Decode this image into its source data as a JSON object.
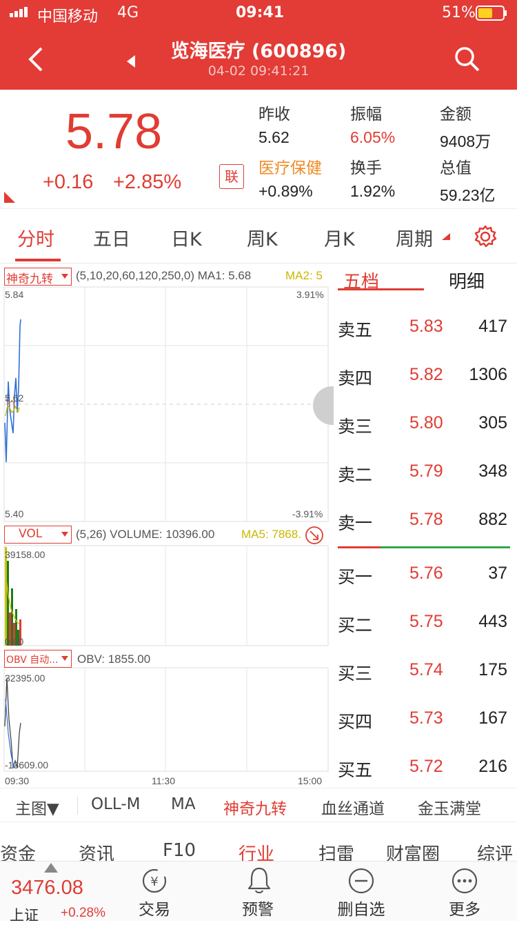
{
  "status_bar": {
    "carrier": "中国移动",
    "network": "4G",
    "time": "09:41",
    "battery": "51%"
  },
  "header": {
    "title": "览海医疗 (600896)",
    "subtitle": "04-02 09:41:21",
    "back_icon": "chevron-left-icon",
    "prev_icon": "caret-left-icon",
    "search_icon": "search-icon"
  },
  "quote": {
    "price": "5.78",
    "change": "+0.16",
    "change_pct": "+2.85%",
    "lian_label": "联",
    "stats": [
      {
        "label": "昨收",
        "value": "5.62",
        "label_color": "#333",
        "value_color": "#222"
      },
      {
        "label": "振幅",
        "value": "6.05%",
        "label_color": "#333",
        "value_color": "#e03c33"
      },
      {
        "label": "金额",
        "value": "9408万",
        "label_color": "#333",
        "value_color": "#222"
      },
      {
        "label": "医疗保健",
        "value": "+0.89%",
        "label_color": "#f08a24",
        "value_color": "#222"
      },
      {
        "label": "换手",
        "value": "1.92%",
        "label_color": "#333",
        "value_color": "#222"
      },
      {
        "label": "总值",
        "value": "59.23亿",
        "label_color": "#333",
        "value_color": "#222"
      }
    ]
  },
  "tabs": [
    "分时",
    "五日",
    "日K",
    "周K",
    "月K",
    "周期"
  ],
  "chart": {
    "main_select": "神奇九转",
    "main_indicator": "(5,10,20,60,120,250,0) MA1: 5.68",
    "ma2": "MA2: 5",
    "y_top": "5.84",
    "y_mid": "5.62",
    "y_bottom": "5.40",
    "pct_top": "3.91%",
    "pct_bottom": "-3.91%",
    "vol_select": "VOL",
    "vol_indicator": "(5,26) VOLUME: 10396.00",
    "vol_ma5": "MA5: 7868.",
    "vol_top": "39158.00",
    "vol_bottom": "0.00",
    "obv_select": "OBV 自动...",
    "obv_indicator": "OBV: 1855.00",
    "obv_top": "32395.00",
    "obv_bottom": "-13609.00",
    "time_start": "09:30",
    "time_mid": "11:30",
    "time_end": "15:00"
  },
  "orderbook": {
    "tabs": [
      "五档",
      "明细"
    ],
    "asks": [
      {
        "name": "卖五",
        "price": "5.83",
        "vol": "417"
      },
      {
        "name": "卖四",
        "price": "5.82",
        "vol": "1306"
      },
      {
        "name": "卖三",
        "price": "5.80",
        "vol": "305"
      },
      {
        "name": "卖二",
        "price": "5.79",
        "vol": "348"
      },
      {
        "name": "卖一",
        "price": "5.78",
        "vol": "882"
      }
    ],
    "bids": [
      {
        "name": "买一",
        "price": "5.76",
        "vol": "37"
      },
      {
        "name": "买二",
        "price": "5.75",
        "vol": "443"
      },
      {
        "name": "买三",
        "price": "5.74",
        "vol": "175"
      },
      {
        "name": "买四",
        "price": "5.73",
        "vol": "167"
      },
      {
        "name": "买五",
        "price": "5.72",
        "vol": "216"
      }
    ]
  },
  "indicator_strip": [
    "主图▼",
    "OLL-M",
    "MA",
    "神奇九转",
    "血丝通道",
    "金玉满堂"
  ],
  "info_tabs": [
    "资金",
    "资讯",
    "F10",
    "行业",
    "扫雷",
    "财富圈",
    "综评"
  ],
  "bottom_nav": {
    "index_value": "3476.08",
    "index_name": "上证",
    "index_change": "+0.28%",
    "items": [
      {
        "label": "交易",
        "icon": "trade-yen-icon"
      },
      {
        "label": "预警",
        "icon": "bell-icon"
      },
      {
        "label": "删自选",
        "icon": "minus-circle-icon"
      },
      {
        "label": "更多",
        "icon": "more-dots-icon"
      }
    ]
  }
}
